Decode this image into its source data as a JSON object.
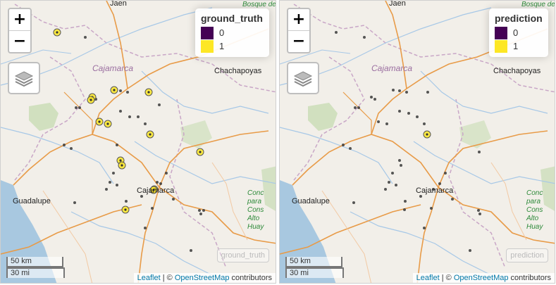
{
  "colors": {
    "class0": "#440154",
    "class1": "#fde725",
    "roads": "#e89b48",
    "rivers": "#a7c8e7",
    "sea": "#a8c8e0",
    "water_line": "#7aa7d8",
    "green": "#c8dcb4"
  },
  "places": {
    "jaen": "Jaen",
    "cajamarca_region": "Cajamarca",
    "chachapoyas": "Chachapoyas",
    "cajamarca_city": "Cajamarca",
    "guadalupe": "Guadalupe",
    "bosque_top": "Bosque de",
    "concesion": "Conc para Cons Alto Huay"
  },
  "controls": {
    "zoom_in": "+",
    "zoom_out": "−",
    "layers_icon": "layers-icon"
  },
  "scale": {
    "km": "50 km",
    "mi": "30 mi"
  },
  "attribution": {
    "leaflet": "Leaflet",
    "sep": " | © ",
    "osm": "OpenStreetMap",
    "contrib": " contributors"
  },
  "left_map": {
    "legend_title": "ground_truth",
    "legend_items": [
      "0",
      "1"
    ],
    "ghost_label": "ground_truth",
    "class1_points": [
      [
        80,
        45
      ],
      [
        161,
        127
      ],
      [
        210,
        130
      ],
      [
        130,
        137
      ],
      [
        128,
        141
      ],
      [
        140,
        172
      ],
      [
        152,
        175
      ],
      [
        212,
        190
      ],
      [
        283,
        215
      ],
      [
        170,
        227
      ],
      [
        172,
        234
      ],
      [
        218,
        268
      ],
      [
        217,
        269
      ],
      [
        177,
        297
      ]
    ],
    "class0_points": [
      [
        120,
        52
      ],
      [
        170,
        128
      ],
      [
        180,
        130
      ],
      [
        135,
        140
      ],
      [
        107,
        152
      ],
      [
        112,
        152
      ],
      [
        170,
        157
      ],
      [
        225,
        148
      ],
      [
        195,
        165
      ],
      [
        183,
        165
      ],
      [
        205,
        175
      ],
      [
        90,
        205
      ],
      [
        100,
        210
      ],
      [
        165,
        205
      ],
      [
        160,
        245
      ],
      [
        155,
        258
      ],
      [
        150,
        268
      ],
      [
        165,
        262
      ],
      [
        235,
        245
      ],
      [
        227,
        260
      ],
      [
        222,
        258
      ],
      [
        200,
        278
      ],
      [
        215,
        295
      ],
      [
        178,
        285
      ],
      [
        105,
        287
      ],
      [
        245,
        282
      ],
      [
        282,
        298
      ],
      [
        284,
        303
      ],
      [
        270,
        355
      ],
      [
        205,
        323
      ],
      [
        288,
        298
      ]
    ]
  },
  "right_map": {
    "legend_title": "prediction",
    "legend_items": [
      "0",
      "1"
    ],
    "ghost_label": "prediction",
    "class1_points": [
      [
        209,
        190
      ]
    ],
    "class0_points": [
      [
        80,
        45
      ],
      [
        120,
        52
      ],
      [
        161,
        127
      ],
      [
        170,
        128
      ],
      [
        180,
        130
      ],
      [
        210,
        130
      ],
      [
        130,
        137
      ],
      [
        135,
        140
      ],
      [
        107,
        152
      ],
      [
        112,
        152
      ],
      [
        170,
        157
      ],
      [
        183,
        160
      ],
      [
        140,
        172
      ],
      [
        152,
        175
      ],
      [
        195,
        165
      ],
      [
        205,
        175
      ],
      [
        90,
        205
      ],
      [
        100,
        210
      ],
      [
        283,
        215
      ],
      [
        170,
        227
      ],
      [
        172,
        234
      ],
      [
        160,
        245
      ],
      [
        155,
        258
      ],
      [
        150,
        268
      ],
      [
        165,
        262
      ],
      [
        235,
        245
      ],
      [
        227,
        260
      ],
      [
        218,
        268
      ],
      [
        200,
        278
      ],
      [
        178,
        285
      ],
      [
        177,
        297
      ],
      [
        215,
        295
      ],
      [
        105,
        287
      ],
      [
        245,
        282
      ],
      [
        282,
        298
      ],
      [
        284,
        303
      ],
      [
        270,
        355
      ],
      [
        205,
        323
      ]
    ]
  }
}
